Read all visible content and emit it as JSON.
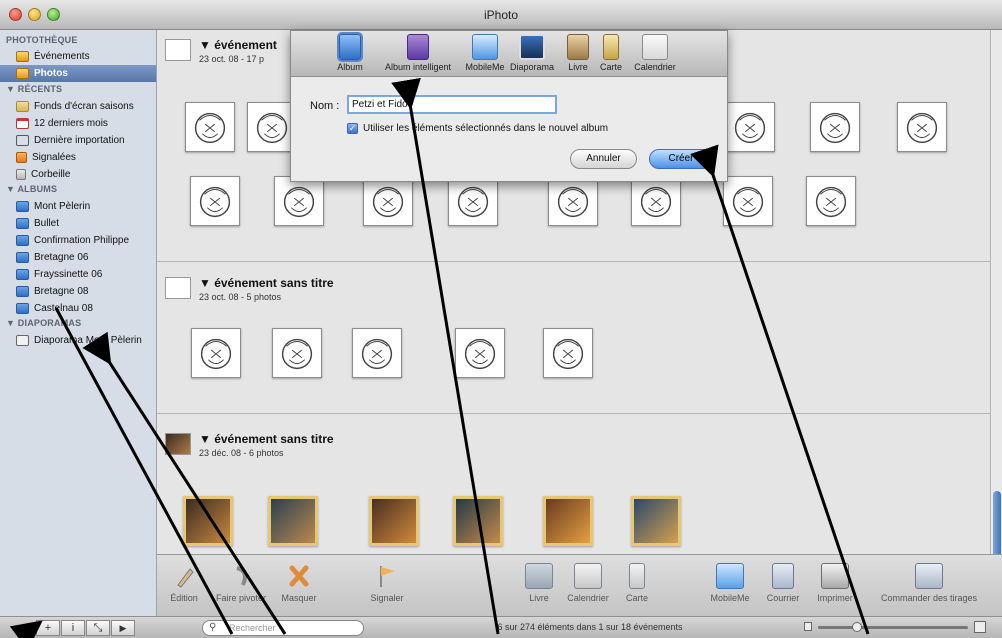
{
  "window": {
    "title": "iPhoto"
  },
  "sidebar": {
    "sections": [
      {
        "label": "PHOTOTHÈQUE"
      },
      {
        "label": "▼ RÉCENTS"
      },
      {
        "label": "▼ ALBUMS"
      },
      {
        "label": "▼ DIAPORAMAS"
      }
    ],
    "items": [
      {
        "label": "Événements",
        "icon": "events-icon"
      },
      {
        "label": "Photos",
        "icon": "photos-icon",
        "selected": true
      },
      {
        "label": "Fonds d'écran saisons",
        "icon": "folder-icon"
      },
      {
        "label": "12 derniers mois",
        "icon": "calendar-icon"
      },
      {
        "label": "Dernière importation",
        "icon": "import-icon"
      },
      {
        "label": "Signalées",
        "icon": "flag-icon"
      },
      {
        "label": "Corbeille",
        "icon": "trash-icon"
      },
      {
        "label": "Mont Pèlerin",
        "icon": "album-icon"
      },
      {
        "label": "Bullet",
        "icon": "album-icon"
      },
      {
        "label": "Confirmation Philippe",
        "icon": "album-icon"
      },
      {
        "label": "Bretagne 06",
        "icon": "album-icon"
      },
      {
        "label": "Frayssinette 06",
        "icon": "album-icon"
      },
      {
        "label": "Bretagne 08",
        "icon": "album-icon"
      },
      {
        "label": "Castelnau 08",
        "icon": "album-icon"
      },
      {
        "label": "Diaporama Mont Pèlerin",
        "icon": "slideshow-icon"
      }
    ]
  },
  "events": [
    {
      "title": "▼ événement",
      "subtitle": "23 oct. 08 - 17 p"
    },
    {
      "title": "▼ événement sans titre",
      "subtitle": "23 oct. 08 - 5 photos"
    },
    {
      "title": "▼ événement sans titre",
      "subtitle": "23 déc. 08 - 6 photos"
    }
  ],
  "dialog": {
    "types": [
      {
        "label": "Album",
        "icon": "album-icon",
        "selected": true
      },
      {
        "label": "Album intelligent",
        "icon": "smart-album-icon"
      },
      {
        "label": "MobileMe",
        "icon": "mobileme-icon"
      },
      {
        "label": "Diaporama",
        "icon": "slideshow-icon"
      },
      {
        "label": "Livre",
        "icon": "book-icon"
      },
      {
        "label": "Carte",
        "icon": "card-icon"
      },
      {
        "label": "Calendrier",
        "icon": "calendar-icon"
      }
    ],
    "name_label": "Nom :",
    "name_value": "Petzi et Fido",
    "checkbox_label": "Utiliser les éléments sélectionnés dans le nouvel album",
    "checkbox_checked": true,
    "cancel_label": "Annuler",
    "create_label": "Créer"
  },
  "toolbar": {
    "left": [
      {
        "label": "Édition",
        "icon": "pencil-icon"
      },
      {
        "label": "Faire pivoter",
        "icon": "rotate-icon"
      },
      {
        "label": "Masquer",
        "icon": "hide-icon"
      },
      {
        "label": "Signaler",
        "icon": "flag-icon"
      }
    ],
    "middle": [
      {
        "label": "Livre",
        "icon": "book-icon"
      },
      {
        "label": "Calendrier",
        "icon": "calendar-icon"
      },
      {
        "label": "Carte",
        "icon": "card-icon"
      }
    ],
    "right": [
      {
        "label": "MobileMe",
        "icon": "mobileme-icon"
      },
      {
        "label": "Courrier",
        "icon": "mail-icon"
      },
      {
        "label": "Imprimer",
        "icon": "print-icon"
      },
      {
        "label": "Commander des tirages",
        "icon": "order-prints-icon"
      }
    ]
  },
  "statusbar": {
    "add_label": "+",
    "info_label": "i",
    "fullscreen_label": "⤡",
    "play_label": "▶",
    "search_placeholder": "Rechercher",
    "count_text": "6 sur 274 éléments dans 1 sur 18 événements"
  },
  "colors": {
    "selection": "#5877a9",
    "accent": "#4e90e8",
    "photo_border": "#e6c874"
  }
}
